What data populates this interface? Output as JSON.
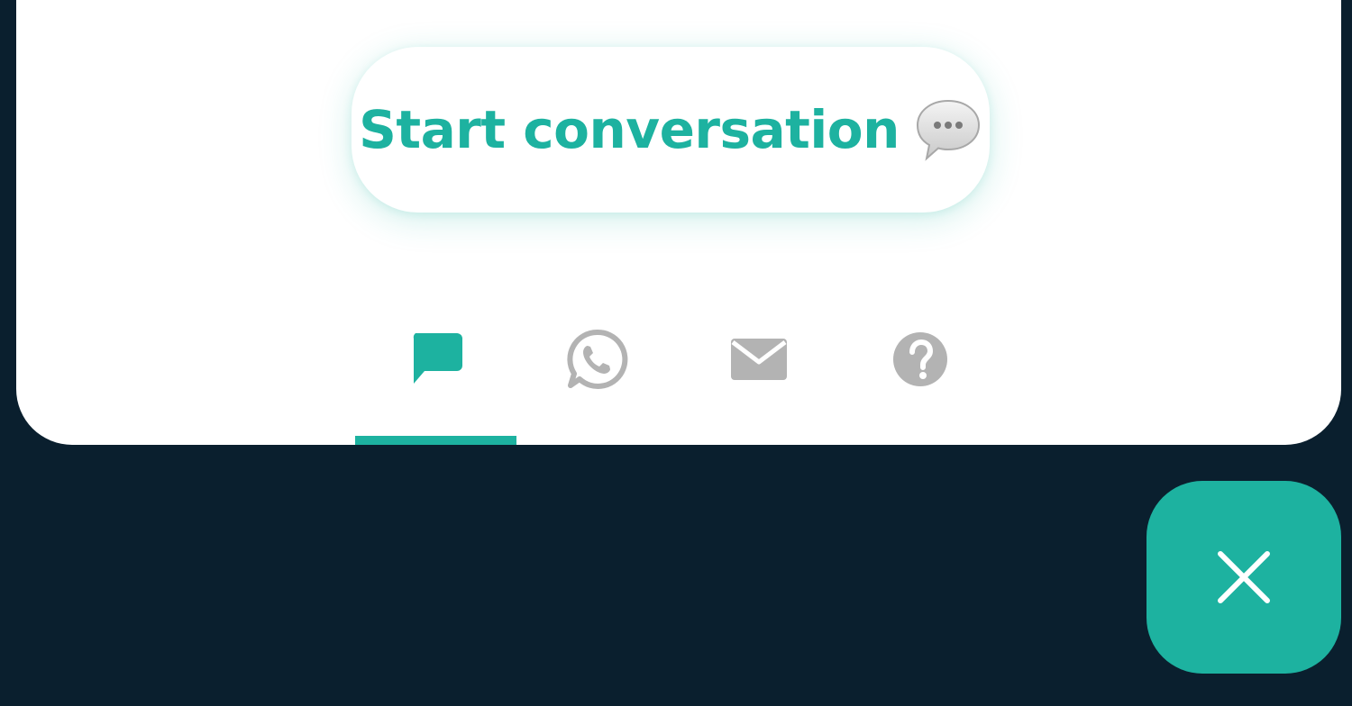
{
  "widget": {
    "start_conversation_label": "Start conversation",
    "start_conversation_icon": "speech-bubble-icon",
    "tabs": [
      {
        "id": "chat",
        "icon": "chat-bubble-icon",
        "active": true
      },
      {
        "id": "whatsapp",
        "icon": "whatsapp-icon",
        "active": false
      },
      {
        "id": "email",
        "icon": "envelope-icon",
        "active": false
      },
      {
        "id": "help",
        "icon": "question-circle-icon",
        "active": false
      }
    ]
  },
  "close_button": {
    "icon": "close-icon"
  },
  "colors": {
    "accent": "#1db2a0",
    "inactive_icon": "#b3b3b3",
    "background": "#0a1f2e",
    "panel": "#ffffff"
  }
}
